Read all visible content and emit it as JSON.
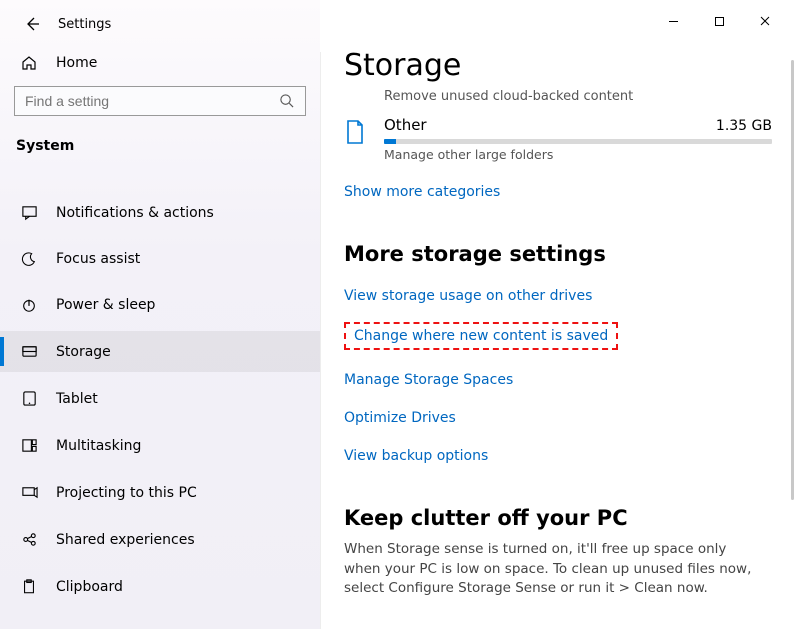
{
  "titlebar": {
    "title": "Settings"
  },
  "sidebar": {
    "home": "Home",
    "search_placeholder": "Find a setting",
    "group": "System",
    "items": [
      {
        "label": "Notifications & actions"
      },
      {
        "label": "Focus assist"
      },
      {
        "label": "Power & sleep"
      },
      {
        "label": "Storage"
      },
      {
        "label": "Tablet"
      },
      {
        "label": "Multitasking"
      },
      {
        "label": "Projecting to this PC"
      },
      {
        "label": "Shared experiences"
      },
      {
        "label": "Clipboard"
      }
    ]
  },
  "main": {
    "page_title": "Storage",
    "cloud_line": "Remove unused cloud-backed content",
    "other": {
      "label": "Other",
      "size": "1.35 GB",
      "desc": "Manage other large folders"
    },
    "show_more": "Show more categories",
    "more_title": "More storage settings",
    "links": {
      "usage": "View storage usage on other drives",
      "change": "Change where new content is saved",
      "spaces": "Manage Storage Spaces",
      "optimize": "Optimize Drives",
      "backup": "View backup options"
    },
    "clutter_title": "Keep clutter off your PC",
    "clutter_body": "When Storage sense is turned on, it'll free up space only when your PC is low on space. To clean up unused files now, select Configure Storage Sense or run it > Clean now."
  }
}
